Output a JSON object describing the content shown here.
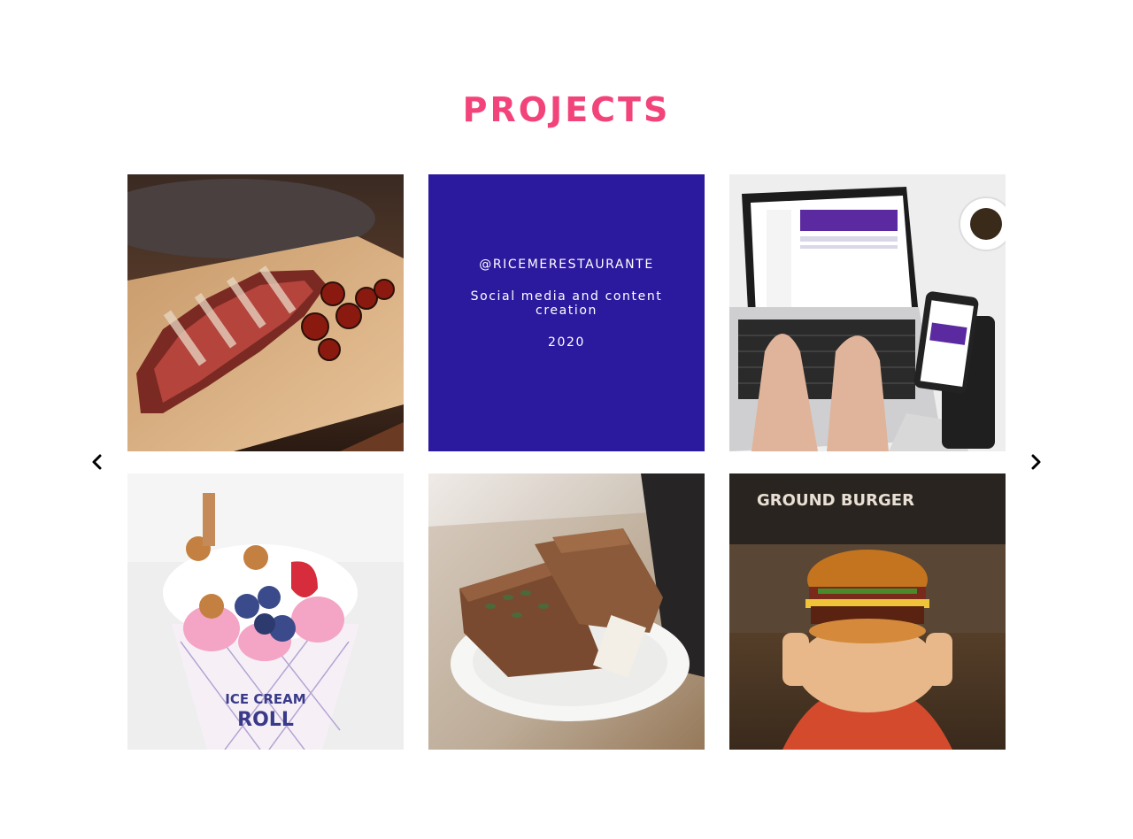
{
  "section": {
    "title": "PROJECTS"
  },
  "gallery": {
    "items": [
      {
        "kind": "image",
        "icon": "steak-photo",
        "description_visible": false
      },
      {
        "kind": "info",
        "handle": "@RICEMERESTAURANTE",
        "description": "Social media and content creation",
        "year": "2020"
      },
      {
        "kind": "image",
        "icon": "laptop-photo"
      },
      {
        "kind": "image",
        "icon": "ice-cream-roll-photo",
        "cup_text_top": "ICE CREAM",
        "cup_text_bottom": "ROLL"
      },
      {
        "kind": "image",
        "icon": "bread-photo"
      },
      {
        "kind": "image",
        "icon": "burger-photo",
        "sign_text": "GROUND BURGER"
      }
    ],
    "nav": {
      "prev_icon": "chevron-left-icon",
      "next_icon": "chevron-right-icon"
    }
  },
  "colors": {
    "title": "#f2447a",
    "info_tile_bg": "#2c1a9e",
    "info_text": "#ffffff"
  }
}
